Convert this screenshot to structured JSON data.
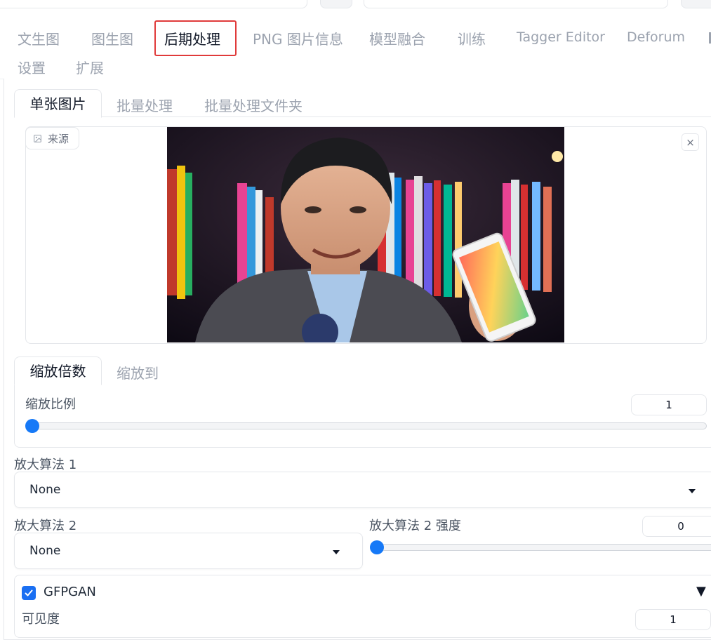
{
  "main_tabs": [
    {
      "label": "文生图"
    },
    {
      "label": "图生图"
    },
    {
      "label": "后期处理"
    },
    {
      "label": "PNG 图片信息"
    },
    {
      "label": "模型融合"
    },
    {
      "label": "训练"
    },
    {
      "label": "Tagger Editor"
    },
    {
      "label": "Deforum"
    },
    {
      "label": "设置"
    },
    {
      "label": "扩展"
    }
  ],
  "sub_tabs": [
    {
      "label": "单张图片"
    },
    {
      "label": "批量处理"
    },
    {
      "label": "批量处理文件夹"
    }
  ],
  "image_input": {
    "label": "来源",
    "close_label": "×"
  },
  "resize_tabs": [
    {
      "label": "缩放倍数"
    },
    {
      "label": "缩放到"
    }
  ],
  "scale": {
    "label": "缩放比例",
    "value": "1"
  },
  "upscaler1": {
    "label": "放大算法 1",
    "value": "None"
  },
  "upscaler2": {
    "label": "放大算法 2",
    "value": "None"
  },
  "upscaler2_strength": {
    "label": "放大算法 2 强度",
    "value": "0"
  },
  "gfpgan": {
    "label": "GFPGAN",
    "collapse_icon": "▼",
    "visibility_label": "可见度",
    "visibility_value": "1"
  },
  "colors": {
    "accent": "#1679f7",
    "highlight_box": "#e03a3a",
    "checkbox": "#1a6ff2"
  }
}
